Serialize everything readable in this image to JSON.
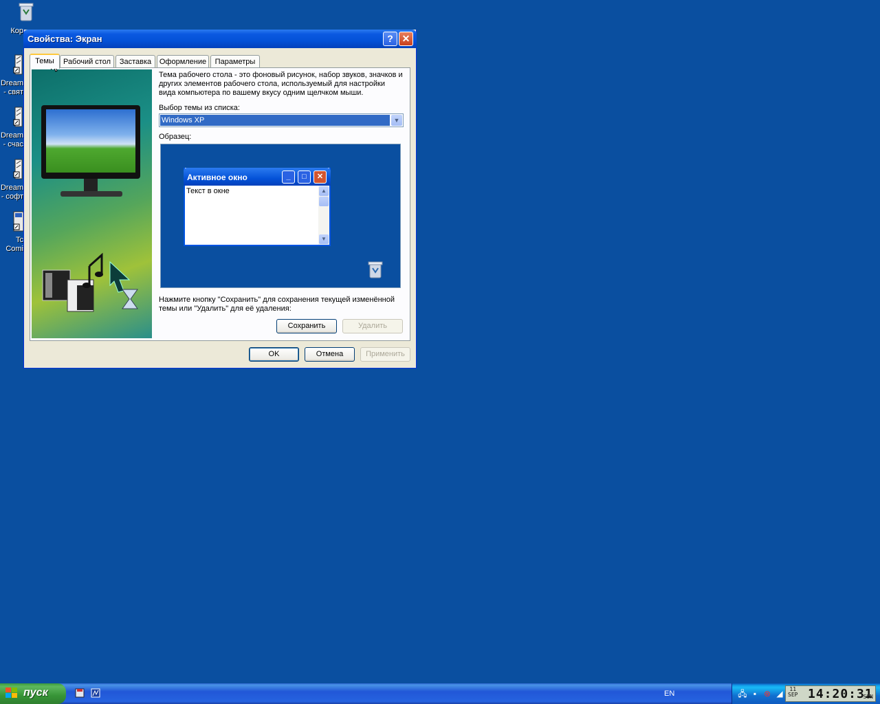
{
  "desktop": {
    "icons": [
      {
        "name": "recycle-bin-icon",
        "label_lines": [
          "Кор"
        ]
      },
      {
        "name": "dream-shortcut-1",
        "label_lines": [
          "Dream",
          "- свят"
        ]
      },
      {
        "name": "dream-shortcut-2",
        "label_lines": [
          "Dream",
          "- счас"
        ]
      },
      {
        "name": "dream-shortcut-3",
        "label_lines": [
          "Dream",
          "- софт"
        ]
      },
      {
        "name": "total-commander-shortcut",
        "label_lines": [
          "Tc",
          "Comi"
        ]
      }
    ]
  },
  "dialog": {
    "title": "Свойства: Экран",
    "help_glyph": "?",
    "close_glyph": "✕",
    "tabs": [
      {
        "label": "Темы",
        "active": true
      },
      {
        "label": "Рабочий стол",
        "active": false
      },
      {
        "label": "Заставка",
        "active": false
      },
      {
        "label": "Оформление",
        "active": false
      },
      {
        "label": "Параметры",
        "active": false
      }
    ],
    "description": "Тема рабочего стола - это фоновый рисунок, набор звуков, значков и других элементов рабочего стола, используемый для настройки вида компьютера по вашему вкусу одним щелчком мыши.",
    "theme_select_label": "Выбор темы из списка:",
    "theme_value": "Windows XP",
    "sample_label": "Образец:",
    "preview": {
      "window_title": "Активное окно",
      "window_text": "Текст в окне"
    },
    "hint": "Нажмите кнопку \"Сохранить\" для сохранения текущей изменённой темы или \"Удалить\" для её удаления:",
    "save_label": "Сохранить",
    "delete_label": "Удалить",
    "ok_label": "OK",
    "cancel_label": "Отмена",
    "apply_label": "Применить"
  },
  "taskbar": {
    "start_label": "пуск",
    "language": "EN",
    "clock": {
      "day": "11",
      "month": "SEP",
      "time": "14:20:31",
      "weekday": "SUN"
    }
  },
  "colors": {
    "desktop": "#0a4fa0",
    "titlebar": "#0452d8",
    "selection": "#316ac5",
    "start": "#379437"
  }
}
